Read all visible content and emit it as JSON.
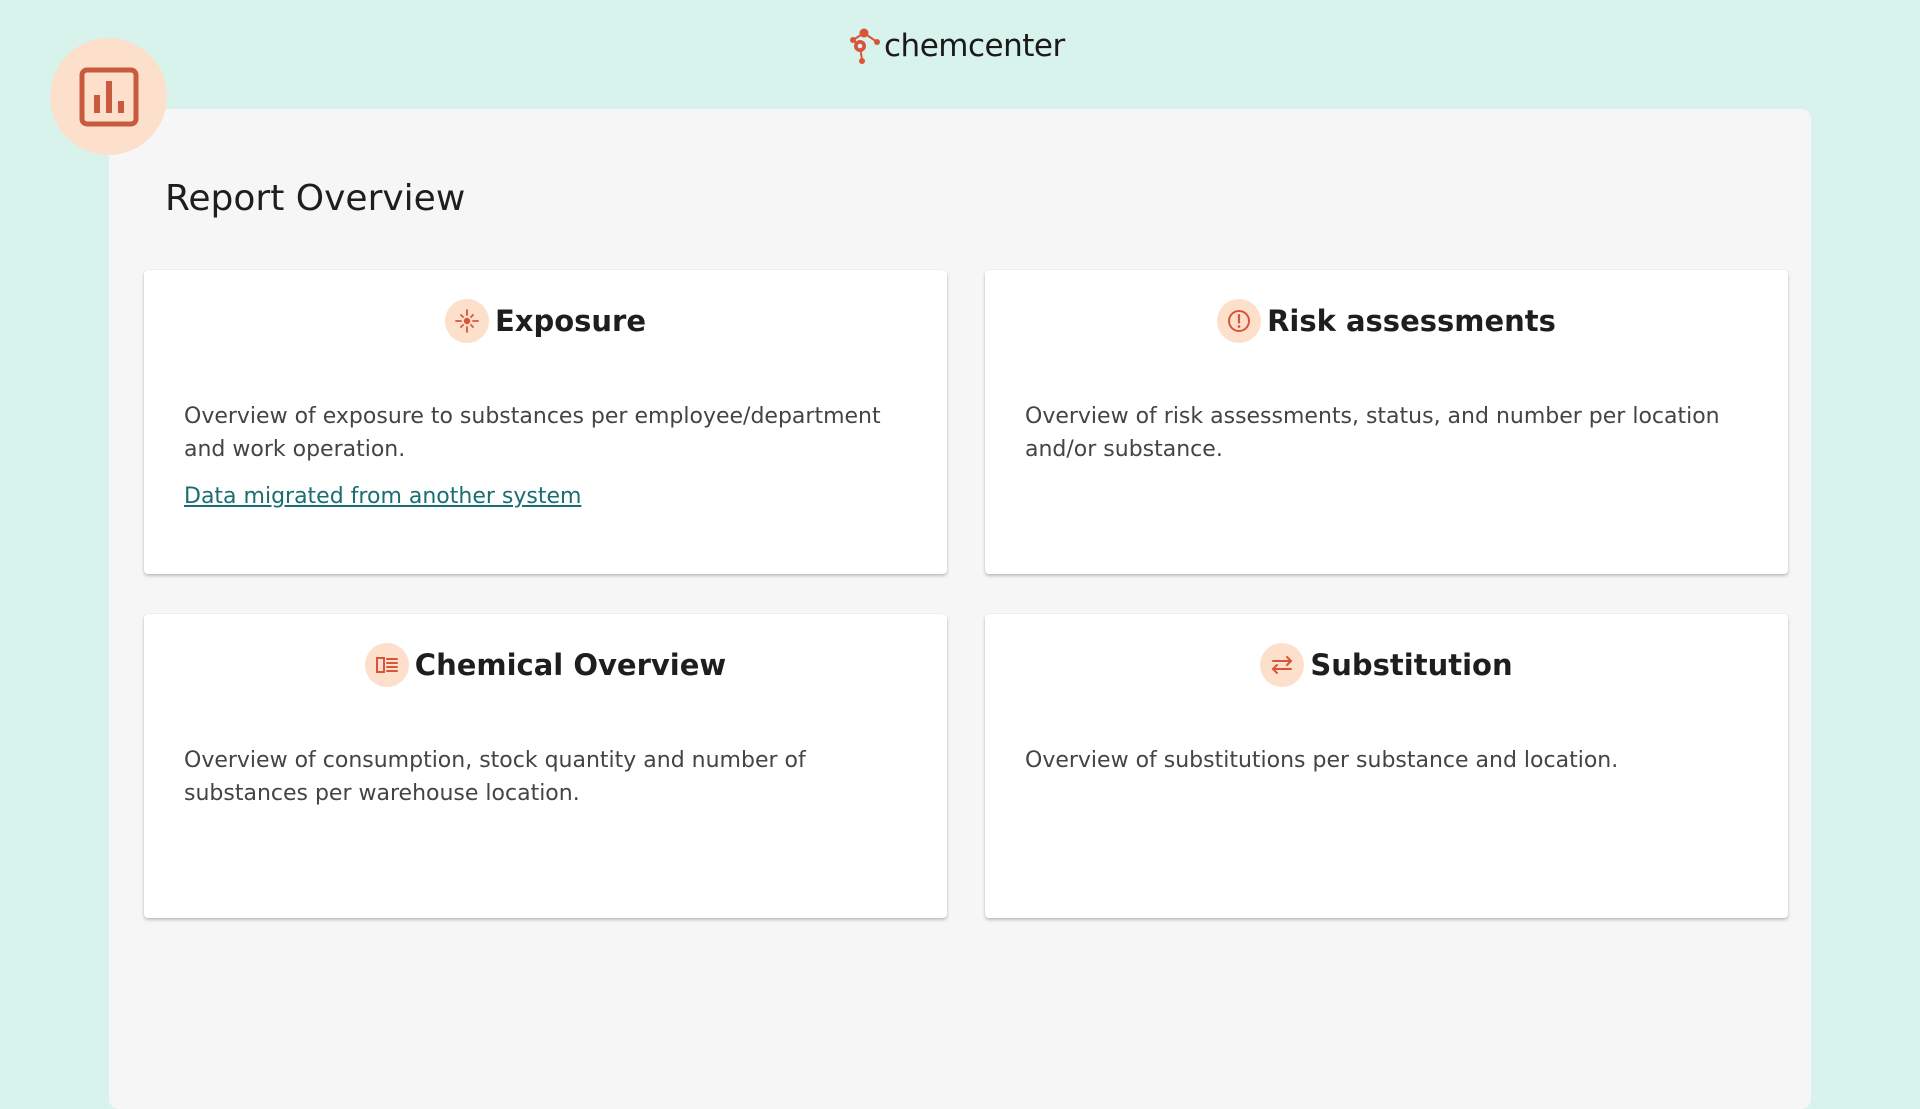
{
  "app": {
    "brand": "chemcenter",
    "page_icon": "bar-chart-icon"
  },
  "page": {
    "title": "Report Overview"
  },
  "colors": {
    "background": "#d8f2ec",
    "panel": "#f6f6f6",
    "accent": "#d9553a",
    "icon_bg": "#fde0cb",
    "link": "#1a6e72"
  },
  "cards": [
    {
      "title": "Exposure",
      "icon": "exposure-icon",
      "description": "Overview of exposure to substances per employee/department and work operation.",
      "link": "Data migrated from another system"
    },
    {
      "title": "Risk assessments",
      "icon": "alert-circle-icon",
      "description": "Overview of risk assessments, status, and number per location and/or substance."
    },
    {
      "title": "Chemical Overview",
      "icon": "list-icon",
      "description": "Overview of consumption, stock quantity and number of substances per warehouse location."
    },
    {
      "title": "Substitution",
      "icon": "swap-icon",
      "description": "Overview of substitutions per substance and location."
    }
  ]
}
